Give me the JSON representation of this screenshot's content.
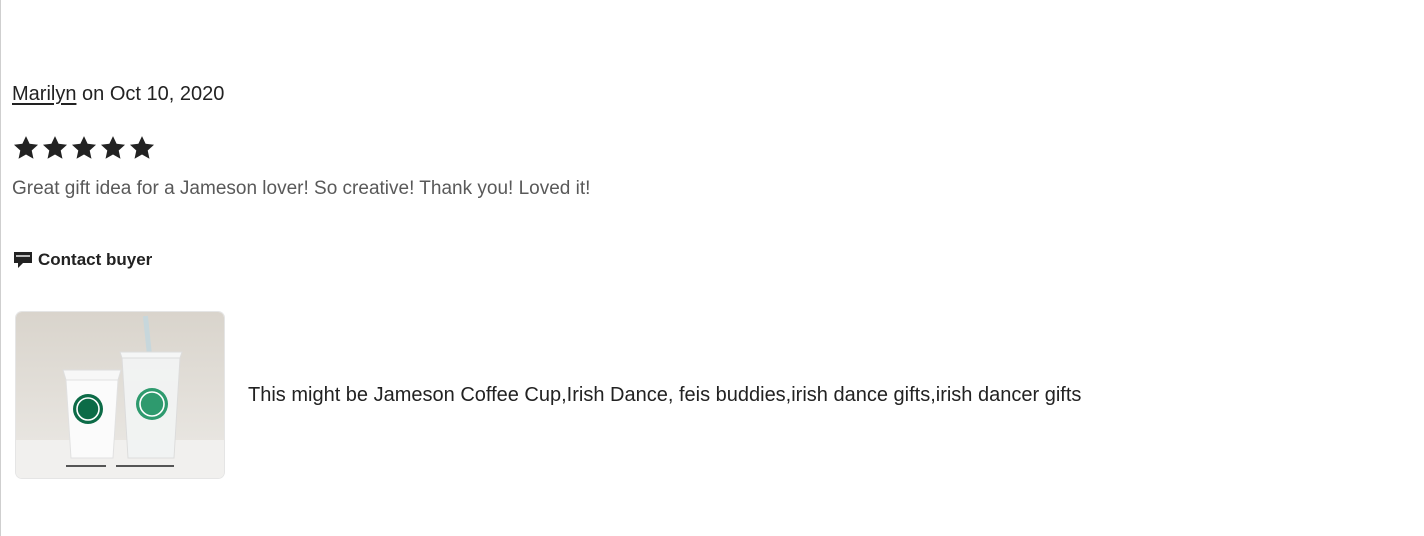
{
  "review": {
    "reviewer_name": "Marilyn",
    "date_text": " on Oct 10, 2020",
    "rating": 5,
    "rating_max": 5,
    "text": "Great gift idea for a Jameson lover! So creative! Thank you! Loved it!",
    "contact_label": "Contact buyer",
    "contact_icon": "message-bubble-icon",
    "star_color": "#222222",
    "item": {
      "title": "This might be Jameson Coffee Cup,Irish Dance, feis buddies,irish dance gifts,irish dancer gifts",
      "thumbnail_icon": "cups-photo"
    }
  }
}
